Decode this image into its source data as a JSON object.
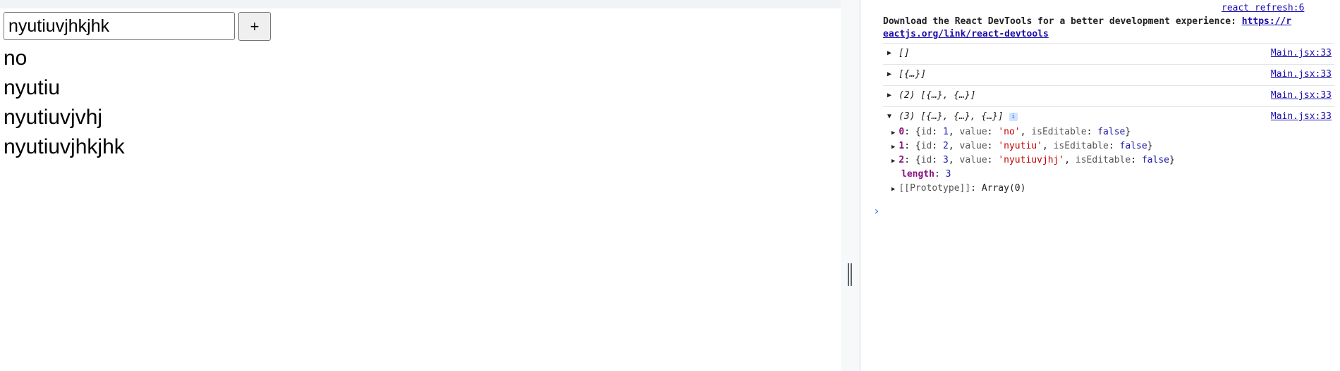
{
  "app": {
    "input_value": "nyutiuvjhkjhk",
    "add_button_label": "+",
    "todos": [
      {
        "label": "no"
      },
      {
        "label": "nyutiu"
      },
      {
        "label": "nyutiuvjvhj"
      },
      {
        "label": "nyutiuvjhkjhk"
      }
    ]
  },
  "console": {
    "refresh_source": "react refresh:6",
    "devtools_message_text": "Download the React DevTools for a better development experience: ",
    "devtools_message_link_line1": "https://r",
    "devtools_message_link_line2": "eactjs.org/link/react-devtools",
    "logs": [
      {
        "preview": "[]",
        "source": "Main.jsx:33"
      },
      {
        "preview": "[{…}]",
        "source": "Main.jsx:33"
      },
      {
        "preview": "(2) [{…}, {…}]",
        "source": "Main.jsx:33"
      },
      {
        "preview": "(3) [{…}, {…}, {…}]",
        "source": "Main.jsx:33"
      }
    ],
    "entries": [
      {
        "key": "0",
        "id": "1",
        "value": "'no'",
        "editable": "false"
      },
      {
        "key": "1",
        "id": "2",
        "value": "'nyutiu'",
        "editable": "false"
      },
      {
        "key": "2",
        "id": "3",
        "value": "'nyutiuvjhj'",
        "editable": "false"
      }
    ],
    "length_key": "length",
    "length_value": "3",
    "prototype_key": "[[Prototype]]",
    "prototype_value": "Array(0)",
    "prop_id": "id",
    "prop_value": "value",
    "prop_editable": "isEditable",
    "info_badge": "i",
    "prompt_symbol": "›"
  }
}
